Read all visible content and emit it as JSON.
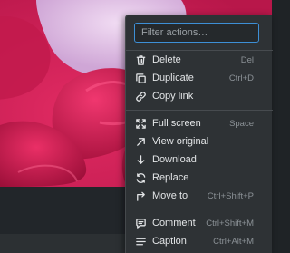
{
  "filter": {
    "placeholder": "Filter actions…"
  },
  "menu": {
    "items": [
      {
        "label": "Delete",
        "shortcut": "Del",
        "icon": "trash-icon"
      },
      {
        "label": "Duplicate",
        "shortcut": "Ctrl+D",
        "icon": "duplicate-icon"
      },
      {
        "label": "Copy link",
        "shortcut": "",
        "icon": "link-icon"
      },
      {
        "label": "Full screen",
        "shortcut": "Space",
        "icon": "fullscreen-icon"
      },
      {
        "label": "View original",
        "shortcut": "",
        "icon": "arrow-up-right-icon"
      },
      {
        "label": "Download",
        "shortcut": "",
        "icon": "download-icon"
      },
      {
        "label": "Replace",
        "shortcut": "",
        "icon": "replace-icon"
      },
      {
        "label": "Move to",
        "shortcut": "Ctrl+Shift+P",
        "icon": "move-to-icon"
      },
      {
        "label": "Comment",
        "shortcut": "Ctrl+Shift+M",
        "icon": "comment-icon"
      },
      {
        "label": "Caption",
        "shortcut": "Ctrl+Alt+M",
        "icon": "caption-icon"
      }
    ]
  },
  "colors": {
    "accent": "#3d8fd6",
    "menu_background": "#2e3235",
    "photo_primary": "#d9245a",
    "photo_highlight": "#e0bde6"
  }
}
